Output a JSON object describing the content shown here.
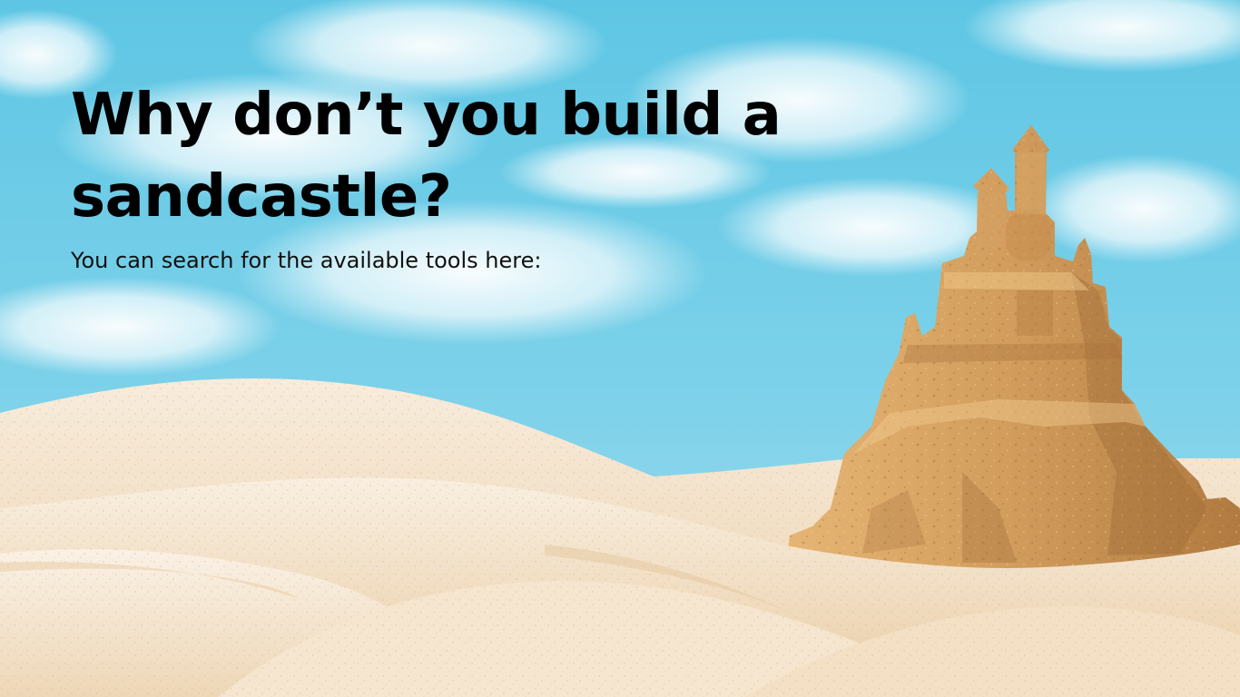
{
  "slide": {
    "title": "Why don’t you build a sandcastle?",
    "subtitle": "You can search for the available tools here:"
  },
  "colors": {
    "sky_top": "#5ec6e4",
    "sky_bottom": "#9fdcee",
    "cloud": "#f4fbfe",
    "sand_light": "#f7ead7",
    "sand_mid": "#efd6b4",
    "sand_shadow": "#e3c29a",
    "castle_light": "#dcaa68",
    "castle_mid": "#c28a4c",
    "castle_dark": "#8e5d2c"
  }
}
